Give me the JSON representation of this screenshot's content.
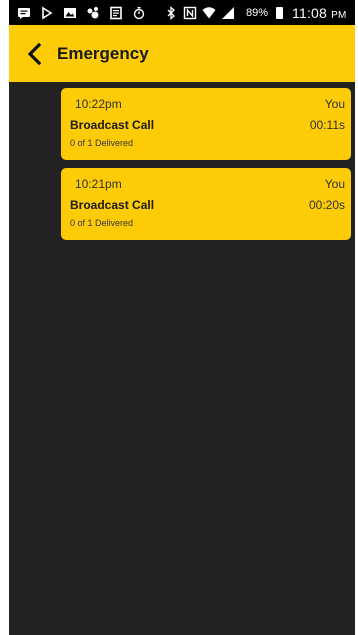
{
  "status_bar": {
    "battery_percent": "89%",
    "time": "11:08",
    "ampm": "PM",
    "icons_left": [
      "message-icon",
      "play-icon",
      "gallery-icon",
      "hangouts-icon",
      "clipboard-icon",
      "stopwatch-icon"
    ],
    "icons_right": [
      "bluetooth-icon",
      "nfc-icon",
      "wifi-icon",
      "signal-icon",
      "battery-icon"
    ]
  },
  "header": {
    "title": "Emergency",
    "back_icon": "chevron-left-icon"
  },
  "messages": [
    {
      "time": "10:22pm",
      "sender": "You",
      "title": "Broadcast Call",
      "duration": "00:11s",
      "status": "0 of 1 Delivered"
    },
    {
      "time": "10:21pm",
      "sender": "You",
      "title": "Broadcast Call",
      "duration": "00:20s",
      "status": "0 of 1 Delivered"
    }
  ],
  "colors": {
    "accent": "#fdcc07",
    "background": "#222222",
    "status_bar": "#000000"
  }
}
